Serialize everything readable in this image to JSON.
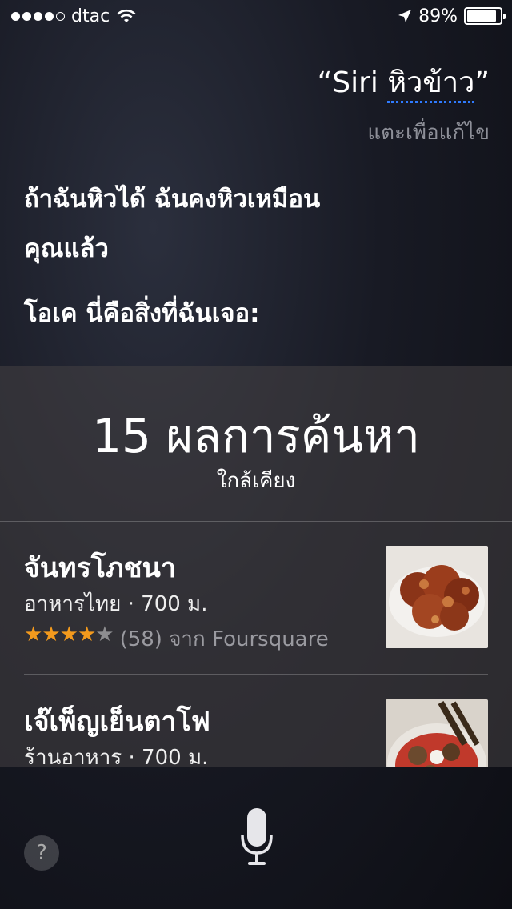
{
  "status_bar": {
    "carrier": "dtac",
    "battery": "89%",
    "battery_level": 0.89,
    "signal_bars": 4,
    "icons": [
      "signal-dots-icon",
      "wifi-icon",
      "location-arrow-icon",
      "battery-icon"
    ]
  },
  "query": {
    "prefix": "“Siri ",
    "underlined": "หิวข้าว",
    "suffix": "”",
    "edit_hint": "แตะเพื่อแก้ไข"
  },
  "response": {
    "line1": "ถ้าฉันหิวได้ ฉันคงหิวเหมือน",
    "line2": "คุณแล้ว",
    "line3": "โอเค นี่คือสิ่งที่ฉันเจอ:"
  },
  "results": {
    "count_label": "15 ผลการค้นหา",
    "subtitle": "ใกล้เคียง",
    "items": [
      {
        "name": "จันทรโภชนา",
        "meta": "อาหารไทย · 700 ม.",
        "stars_filled": 4,
        "stars_total": 5,
        "rating_text": "(58) จาก Foursquare"
      },
      {
        "name": "เจ๊เพ็ญเย็นตาโฟ",
        "meta": "ร้านอาหาร · 700 ม."
      }
    ]
  },
  "bottom": {
    "help_label": "?",
    "icons": [
      "help-icon",
      "microphone-icon"
    ]
  },
  "colors": {
    "accent_blue": "#2f7bff",
    "star_orange": "#f39a1d",
    "hint_gray": "#8d8f98"
  }
}
